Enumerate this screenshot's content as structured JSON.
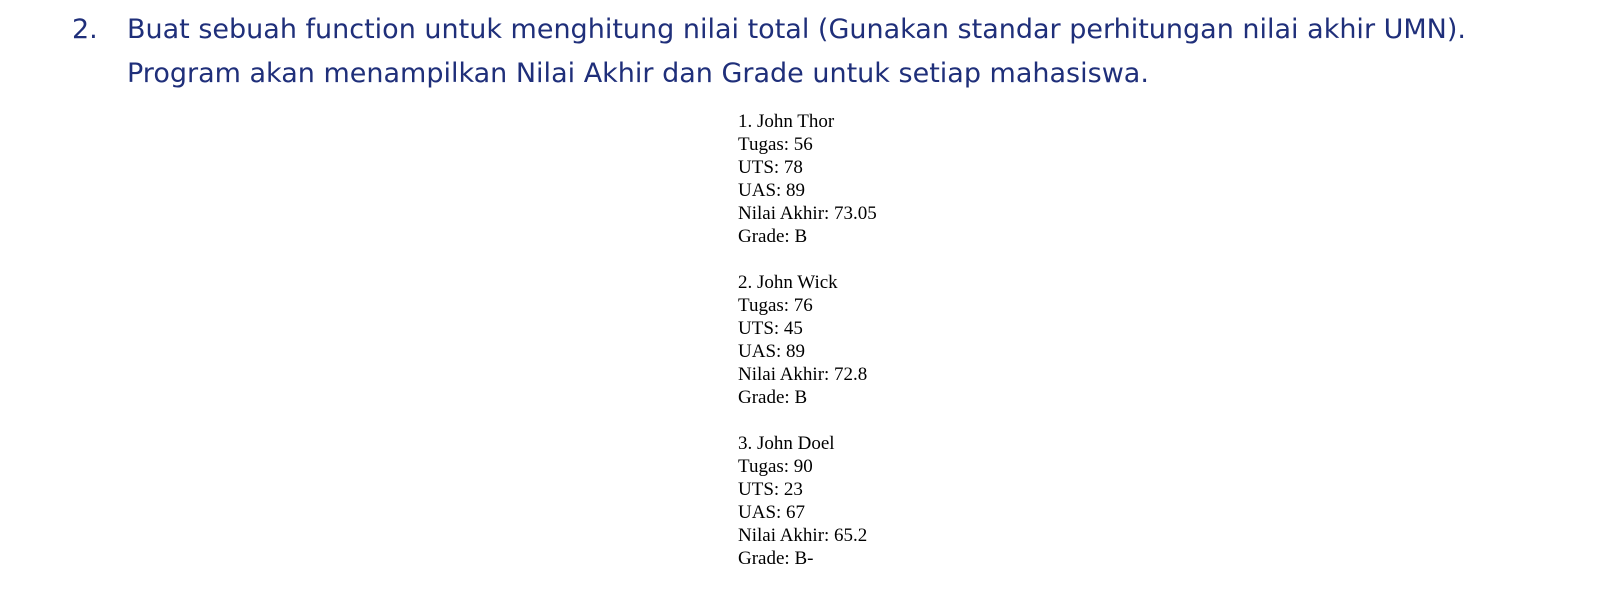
{
  "task": {
    "number": "2.",
    "line1": "Buat sebuah function untuk menghitung nilai total (Gunakan standar perhitungan nilai akhir UMN).",
    "line2": "Program akan menampilkan Nilai Akhir dan Grade untuk setiap mahasiswa."
  },
  "output": {
    "students": [
      {
        "title": "1. John Thor",
        "tugas": "Tugas: 56",
        "uts": "UTS: 78",
        "uas": "UAS: 89",
        "nilai_akhir": "Nilai Akhir: 73.05",
        "grade": "Grade: B"
      },
      {
        "title": "2. John Wick",
        "tugas": "Tugas: 76",
        "uts": "UTS: 45",
        "uas": "UAS: 89",
        "nilai_akhir": "Nilai Akhir: 72.8",
        "grade": "Grade: B"
      },
      {
        "title": "3. John Doel",
        "tugas": "Tugas: 90",
        "uts": "UTS: 23",
        "uas": "UAS: 67",
        "nilai_akhir": "Nilai Akhir: 65.2",
        "grade": "Grade: B-"
      }
    ]
  }
}
